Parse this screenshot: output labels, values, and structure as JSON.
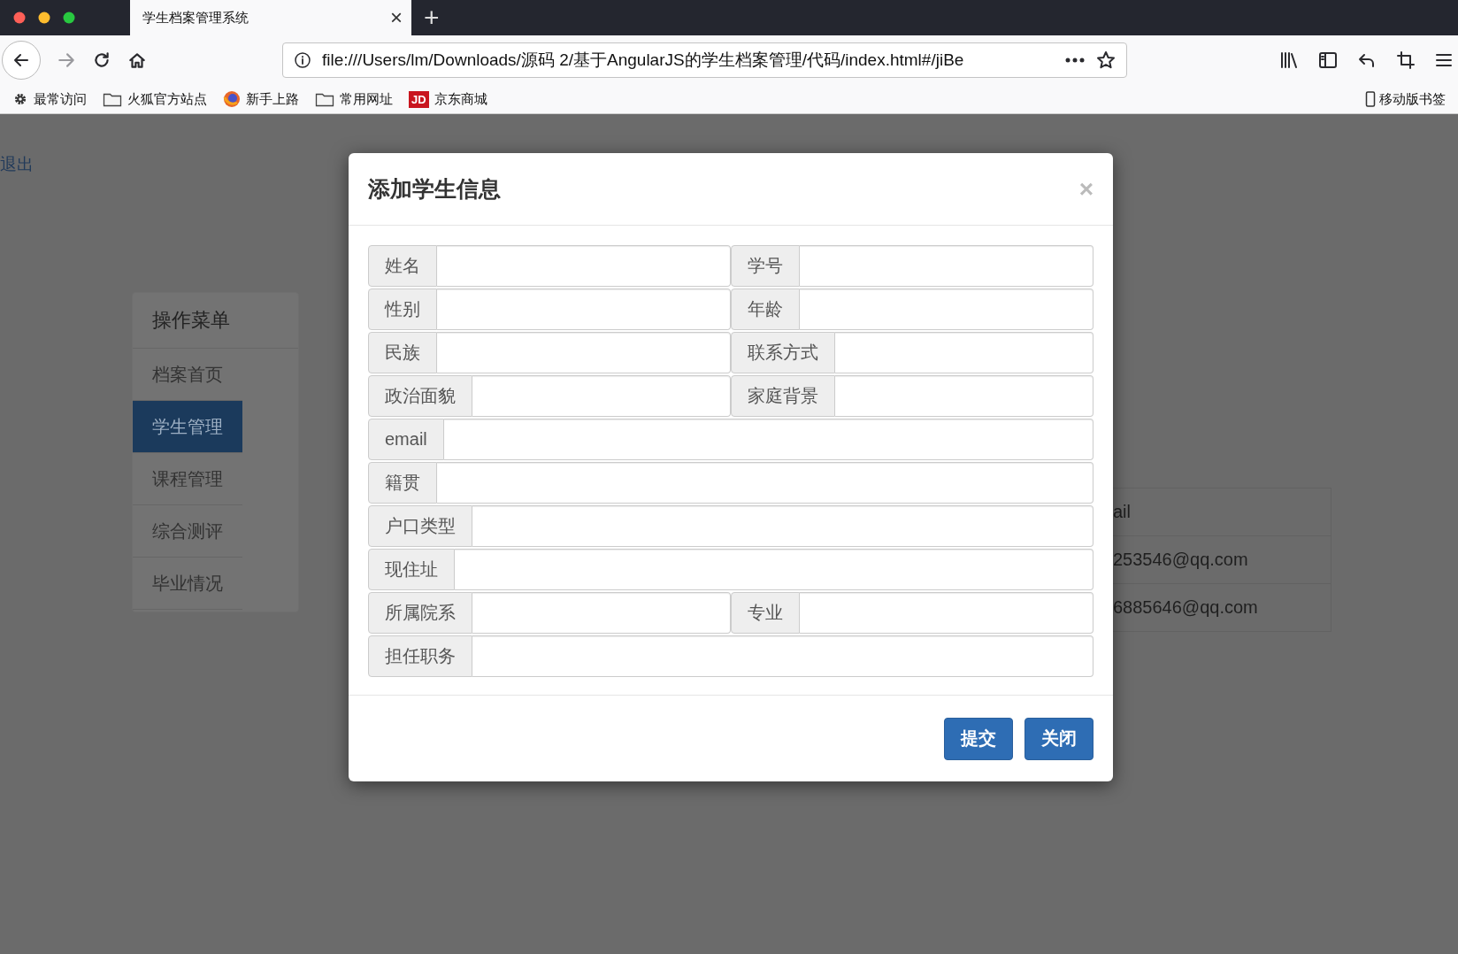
{
  "browser": {
    "tabs": [
      {
        "title": "学生档案管理系统",
        "selected": true,
        "close": "×"
      }
    ],
    "new_tab": "+",
    "url": "file:///Users/lm/Downloads/源码 2/基于AngularJS的学生档案管理/代码/index.html#/jiBe",
    "bookmarks": [
      {
        "label": "最常访问",
        "kind": "gear"
      },
      {
        "label": "火狐官方站点",
        "kind": "folder"
      },
      {
        "label": "新手上路",
        "kind": "firefox"
      },
      {
        "label": "常用网址",
        "kind": "folder"
      },
      {
        "label": "京东商城",
        "kind": "jd",
        "badge": "JD"
      }
    ],
    "mobile_bookmarks": "移动版书签"
  },
  "page": {
    "logout": "退出",
    "menu": {
      "title": "操作菜单",
      "items": [
        {
          "label": "档案首页",
          "selected": false
        },
        {
          "label": "学生管理",
          "selected": true
        },
        {
          "label": "课程管理",
          "selected": false
        },
        {
          "label": "综合测评",
          "selected": false
        },
        {
          "label": "毕业情况",
          "selected": false
        }
      ]
    },
    "table": {
      "column_header": "ail",
      "cells": [
        "253546@qq.com",
        "6885646@qq.com"
      ]
    }
  },
  "dialog": {
    "title": "添加学生信息",
    "close": "×",
    "rows": [
      {
        "fields": [
          "姓名",
          "学号"
        ]
      },
      {
        "fields": [
          "性别",
          "年龄"
        ]
      },
      {
        "fields": [
          "民族",
          "联系方式"
        ]
      },
      {
        "fields": [
          "政治面貌",
          "家庭背景"
        ]
      },
      {
        "fields": [
          "email"
        ]
      },
      {
        "fields": [
          "籍贯"
        ]
      },
      {
        "fields": [
          "户口类型"
        ]
      },
      {
        "fields": [
          "现住址"
        ]
      },
      {
        "fields": [
          "所属院系",
          "专业"
        ]
      },
      {
        "fields": [
          "担任职务"
        ]
      }
    ],
    "buttons": [
      "提交",
      "关闭"
    ]
  }
}
